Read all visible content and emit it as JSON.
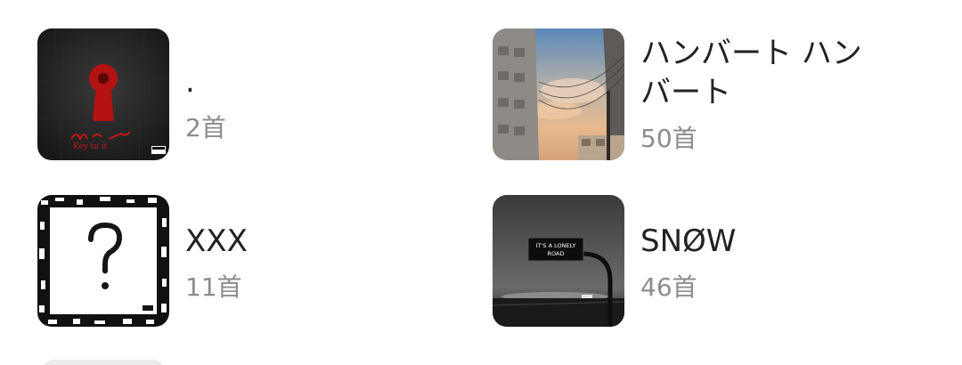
{
  "albums": [
    {
      "title": ".",
      "count": "2首",
      "cover_icon": "keyhole-art-icon",
      "cover_text": "Key to it"
    },
    {
      "title": "ハンバート ハンバート",
      "count": "50首",
      "cover_icon": "city-sky-icon"
    },
    {
      "title": "XXX",
      "count": "11首",
      "cover_icon": "question-mark-art-icon"
    },
    {
      "title": "SNØW",
      "count": "46首",
      "cover_icon": "lonely-road-sign-icon",
      "cover_text_line1": "IT'S A LONELY",
      "cover_text_line2": "ROAD"
    }
  ],
  "colors": {
    "title": "#222222",
    "count": "#8c8c8c",
    "background": "#ffffff"
  }
}
